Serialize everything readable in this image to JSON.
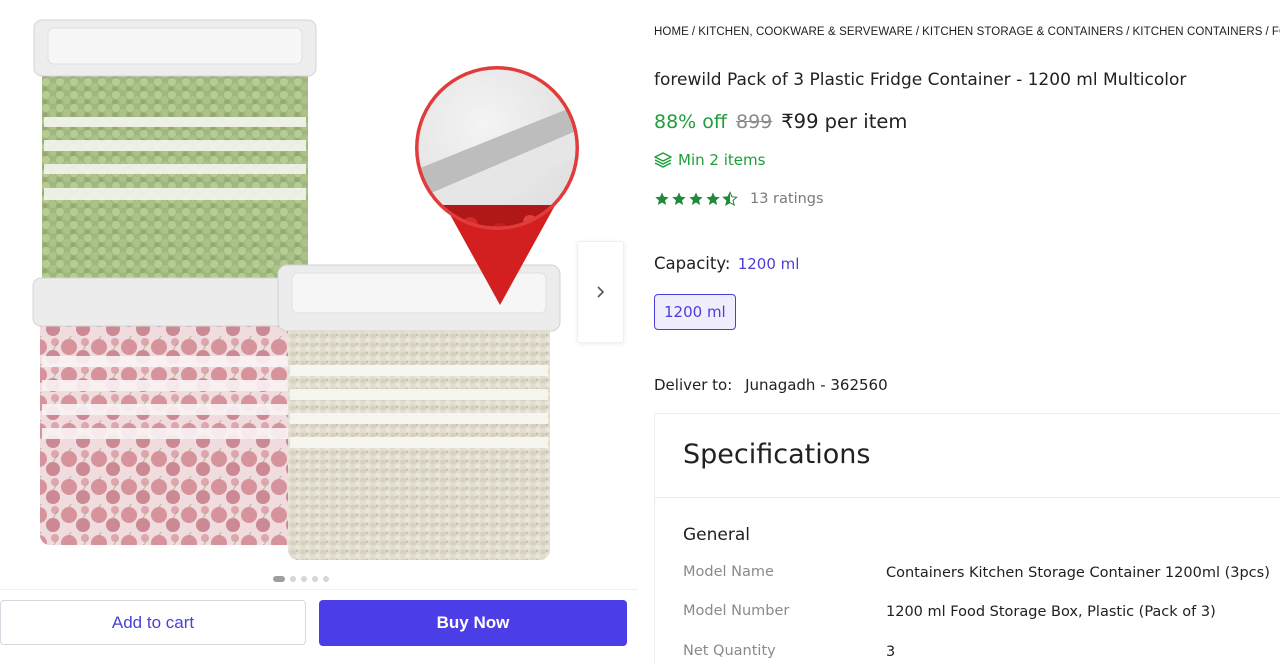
{
  "breadcrumb": [
    "HOME",
    "KITCHEN, COOKWARE & SERVEWARE",
    "KITCHEN STORAGE & CONTAINERS",
    "KITCHEN CONTAINERS",
    "FOREWILD KITCHEN CONTAINERS"
  ],
  "product": {
    "title": "forewild Pack of 3 Plastic Fridge Container  - 1200 ml Multicolor",
    "discount": "88% off",
    "mrp": "899",
    "price": "₹99 per item",
    "min_qty": "Min 2 items",
    "rating_stars": 4.5,
    "ratings_text": "13 ratings"
  },
  "capacity": {
    "label": "Capacity:",
    "selected": "1200 ml",
    "options": [
      "1200 ml"
    ]
  },
  "delivery": {
    "label": "Deliver to:",
    "location": "Junagadh - 362560"
  },
  "gallery": {
    "image_count": 5,
    "active_index": 0
  },
  "actions": {
    "add_to_cart": "Add to cart",
    "buy_now": "Buy Now"
  },
  "specifications": {
    "heading": "Specifications",
    "group": "General",
    "rows": [
      {
        "key": "Model Name",
        "value": "Containers Kitchen Storage Container 1200ml (3pcs)"
      },
      {
        "key": "Model Number",
        "value": "1200 ml Food Storage Box, Plastic (Pack of 3)"
      },
      {
        "key": "Net Quantity",
        "value": "3"
      }
    ]
  },
  "colors": {
    "accent": "#4a3fd8",
    "green": "#1f9d3a",
    "star": "#1f8a3a"
  },
  "icons": {
    "next": "chevron-right-icon",
    "min_items": "layers-icon",
    "star": "star-icon"
  }
}
